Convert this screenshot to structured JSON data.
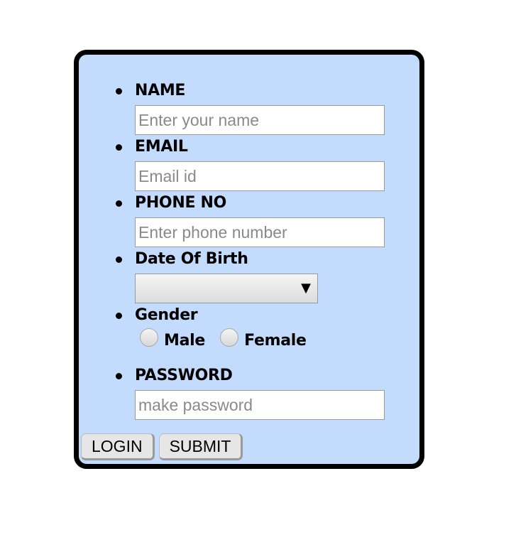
{
  "form": {
    "fields": [
      {
        "label": "NAME",
        "placeholder": "Enter your name"
      },
      {
        "label": "EMAIL",
        "placeholder": "Email id"
      },
      {
        "label": "PHONE NO",
        "placeholder": "Enter phone number"
      },
      {
        "label": "Date Of Birth"
      },
      {
        "label": "Gender",
        "options": [
          "Male",
          "Female"
        ]
      },
      {
        "label": "PASSWORD",
        "placeholder": "make password"
      }
    ],
    "dob_select": {
      "selected": "",
      "arrow_icon": "dropdown-arrow-icon"
    },
    "buttons": {
      "login": "LOGIN",
      "submit": "SUBMIT"
    }
  },
  "colors": {
    "card_background": "#c3dbfd",
    "card_border": "#000000",
    "input_background": "#ffffff",
    "button_background": "#e6e6e6"
  }
}
